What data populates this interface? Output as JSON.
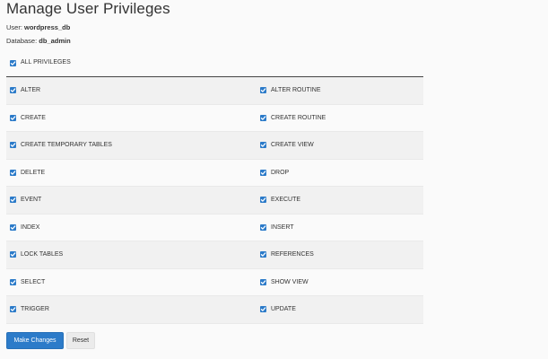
{
  "header": {
    "title": "Manage User Privileges",
    "user_label": "User:",
    "user_value": "wordpress_db",
    "db_label": "Database:",
    "db_value": "db_admin"
  },
  "all_privileges": {
    "label": "ALL PRIVILEGES",
    "checked": true
  },
  "privileges": [
    {
      "left": "ALTER",
      "right": "ALTER ROUTINE"
    },
    {
      "left": "CREATE",
      "right": "CREATE ROUTINE"
    },
    {
      "left": "CREATE TEMPORARY TABLES",
      "right": "CREATE VIEW"
    },
    {
      "left": "DELETE",
      "right": "DROP"
    },
    {
      "left": "EVENT",
      "right": "EXECUTE"
    },
    {
      "left": "INDEX",
      "right": "INSERT"
    },
    {
      "left": "LOCK TABLES",
      "right": "REFERENCES"
    },
    {
      "left": "SELECT",
      "right": "SHOW VIEW"
    },
    {
      "left": "TRIGGER",
      "right": "UPDATE"
    }
  ],
  "actions": {
    "submit_label": "Make Changes",
    "reset_label": "Reset"
  },
  "colors": {
    "accent": "#2c7bc9",
    "row_alt": "#f1f1f1",
    "background": "#fafafa"
  },
  "icons": {
    "checkbox": "checkbox-checked-icon"
  }
}
